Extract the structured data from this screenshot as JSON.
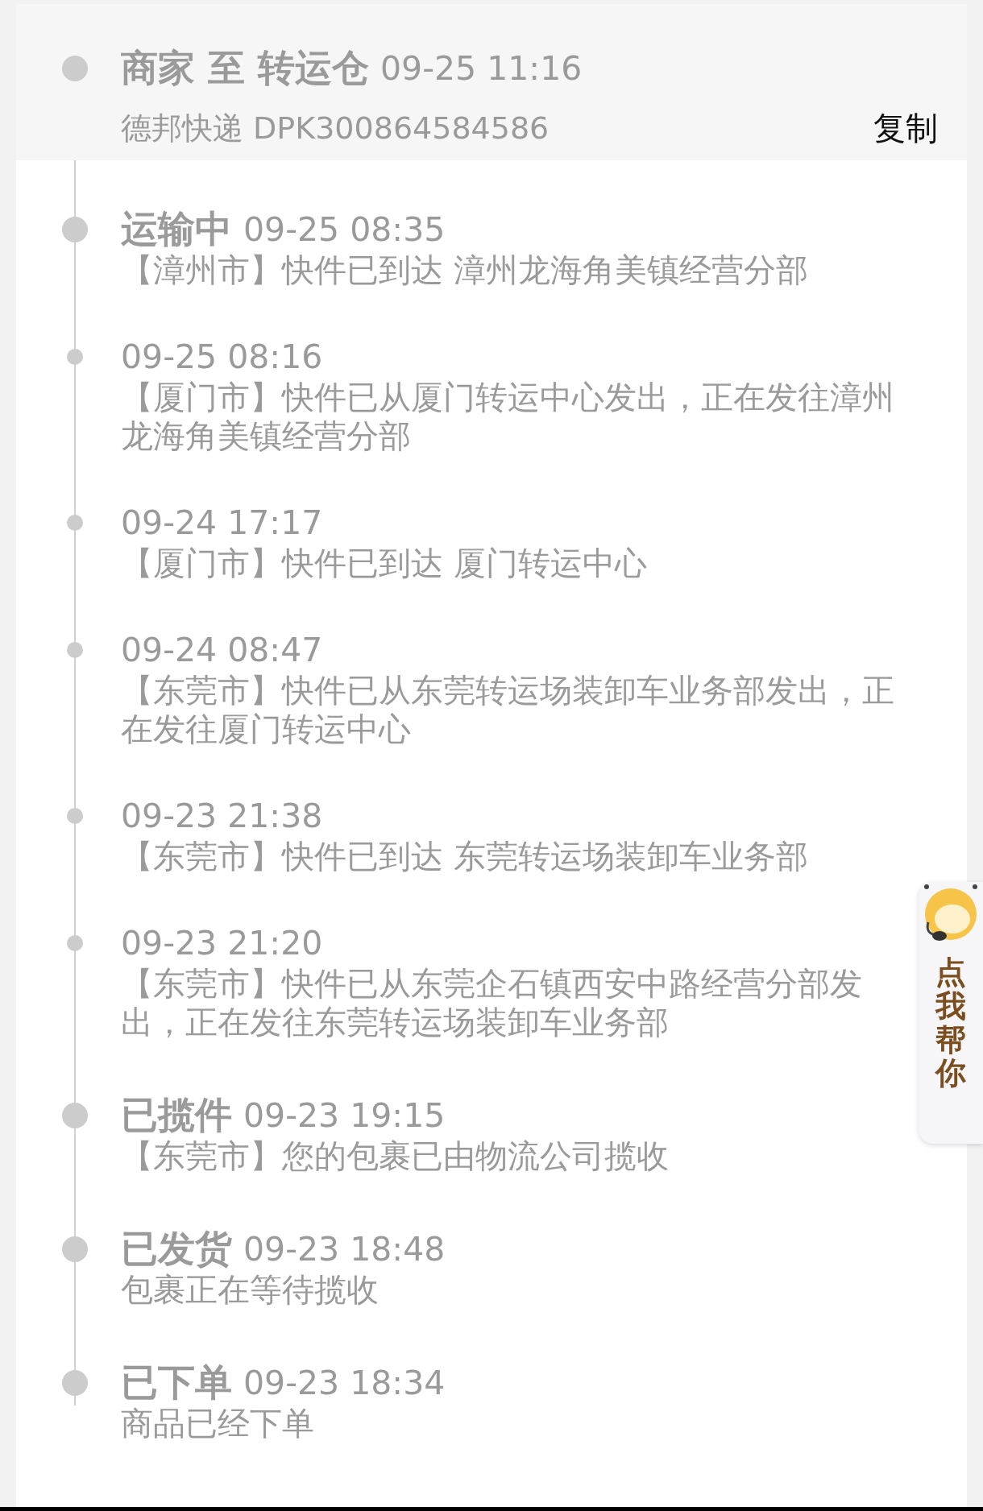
{
  "header": {
    "title": "商家 至 转运仓",
    "time": "09-25 11:16",
    "carrier": "德邦快递 DPK300864584586",
    "copy_button": "复制"
  },
  "events": [
    {
      "kind": "major",
      "status": "运输中",
      "time": "09-25 08:35",
      "desc": "【漳州市】快件已到达 漳州龙海角美镇经营分部"
    },
    {
      "kind": "minor",
      "time": "09-25 08:16",
      "desc": "【厦门市】快件已从厦门转运中心发出，正在发往漳州龙海角美镇经营分部"
    },
    {
      "kind": "minor",
      "time": "09-24 17:17",
      "desc": "【厦门市】快件已到达 厦门转运中心"
    },
    {
      "kind": "minor",
      "time": "09-24 08:47",
      "desc": "【东莞市】快件已从东莞转运场装卸车业务部发出，正在发往厦门转运中心"
    },
    {
      "kind": "minor",
      "time": "09-23 21:38",
      "desc": "【东莞市】快件已到达 东莞转运场装卸车业务部"
    },
    {
      "kind": "minor",
      "time": "09-23 21:20",
      "desc": "【东莞市】快件已从东莞企石镇西安中路经营分部发出，正在发往东莞转运场装卸车业务部"
    },
    {
      "kind": "major",
      "status": "已揽件",
      "time": "09-23 19:15",
      "desc": "【东莞市】您的包裹已由物流公司揽收"
    },
    {
      "kind": "major",
      "status": "已发货",
      "time": "09-23 18:48",
      "desc": "包裹正在等待揽收"
    },
    {
      "kind": "major",
      "status": "已下单",
      "time": "09-23 18:34",
      "desc": "商品已经下单"
    }
  ],
  "helper": {
    "label": "点我帮你"
  }
}
